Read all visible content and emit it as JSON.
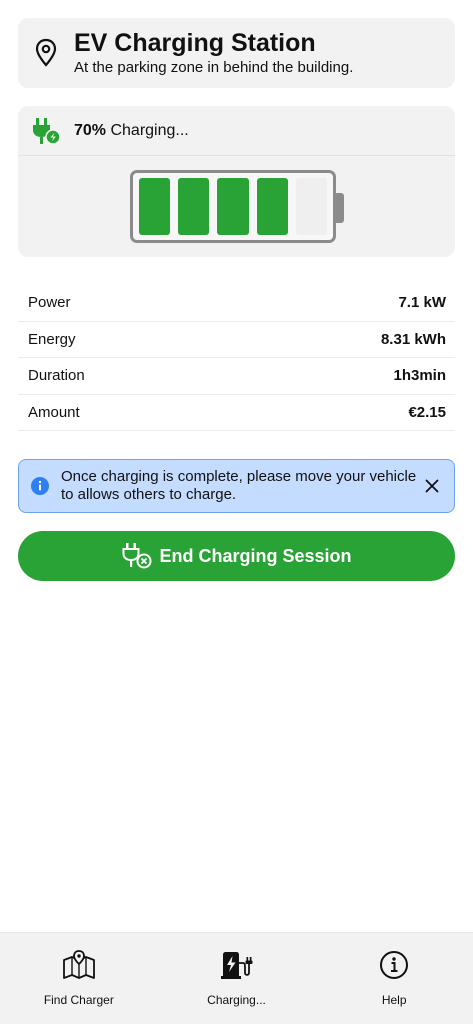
{
  "station": {
    "title": "EV Charging Station",
    "subtitle": "At the parking zone in behind the building."
  },
  "charging": {
    "percent_label": "70%",
    "status": " Charging...",
    "level_fraction": 0.7,
    "cells_total": 5,
    "cells_filled": 4
  },
  "stats": [
    {
      "label": "Power",
      "value": "7.1 kW"
    },
    {
      "label": "Energy",
      "value": "8.31 kWh"
    },
    {
      "label": "Duration",
      "value": "1h3min"
    },
    {
      "label": "Amount",
      "value": "€2.15"
    }
  ],
  "notice": {
    "text": "Once charging is complete, please move your vehicle to allows others to charge."
  },
  "end_button": {
    "label": "End Charging Session"
  },
  "nav": [
    {
      "label": "Find Charger",
      "icon": "map-icon"
    },
    {
      "label": "Charging...",
      "icon": "charging-station-icon"
    },
    {
      "label": "Help",
      "icon": "info-icon"
    }
  ],
  "colors": {
    "accent": "#2aa336",
    "notice_bg": "#c4dcff",
    "notice_border": "#6ea2ef",
    "info_blue": "#2f7ff0",
    "card_bg": "#f2f2f2"
  }
}
